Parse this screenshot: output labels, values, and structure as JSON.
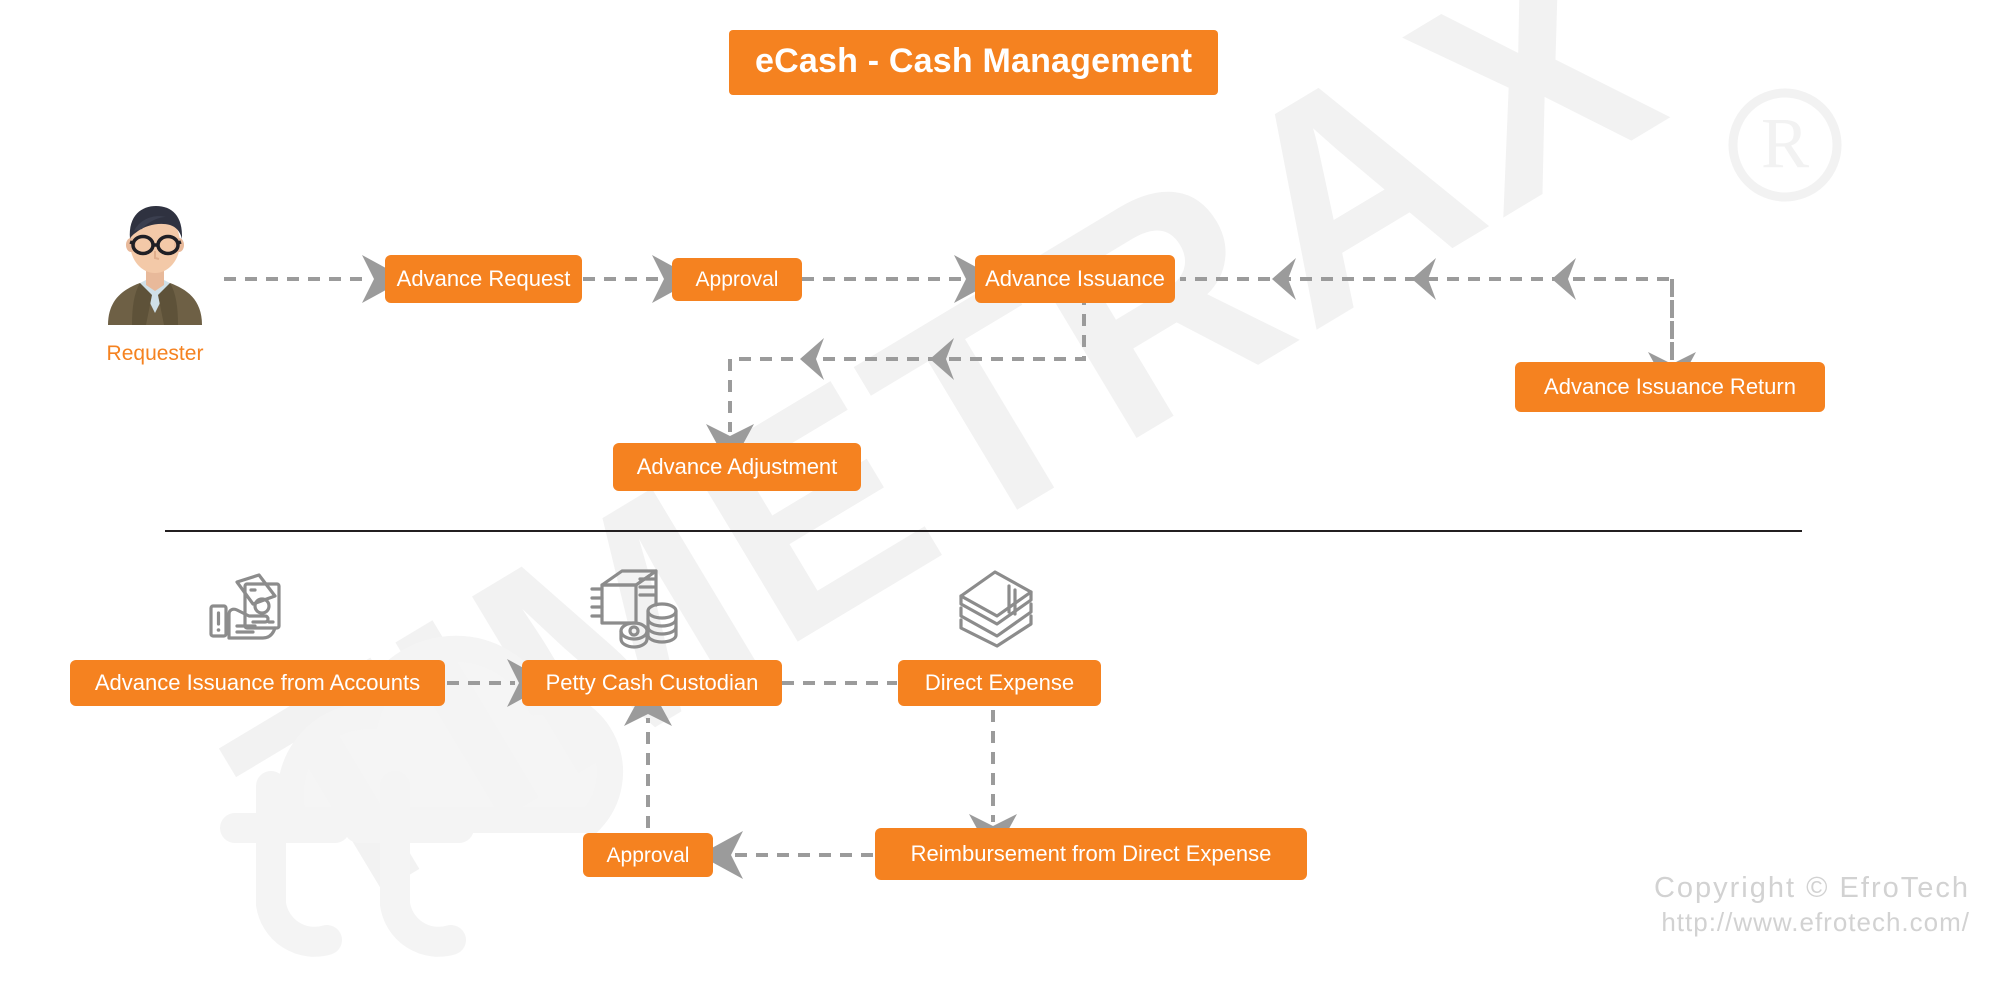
{
  "page": {
    "title": "eCash - Cash Management",
    "background_color": "#ffffff",
    "accent_color": "#F58220",
    "connector_color": "#9b9b9b",
    "divider_color": "#231f20",
    "watermark_text": "TIMETRAX",
    "watermark_registered_mark": "®"
  },
  "actor": {
    "label": "Requester",
    "icon": "person-avatar-icon"
  },
  "top_flow": {
    "nodes": [
      {
        "id": "advance-request",
        "label": "Advance Request"
      },
      {
        "id": "approval-top",
        "label": "Approval"
      },
      {
        "id": "advance-issuance",
        "label": "Advance Issuance"
      },
      {
        "id": "advance-issuance-return",
        "label": "Advance Issuance Return"
      },
      {
        "id": "advance-adjustment",
        "label": "Advance Adjustment"
      }
    ]
  },
  "bottom_flow": {
    "nodes": [
      {
        "id": "advance-issuance-from-accounts",
        "label": "Advance Issuance from Accounts",
        "icon": "hand-holding-cash-icon"
      },
      {
        "id": "petty-cash-custodian",
        "label": "Petty Cash Custodian",
        "icon": "cash-and-coins-icon"
      },
      {
        "id": "direct-expense",
        "label": "Direct Expense",
        "icon": "banknote-stack-icon"
      },
      {
        "id": "approval-bottom",
        "label": "Approval",
        "icon": ""
      },
      {
        "id": "reimbursement-from-direct-expense",
        "label": "Reimbursement from Direct Expense",
        "icon": ""
      }
    ]
  },
  "footer": {
    "copyright": "Copyright © EfroTech",
    "url": "http://www.efrotech.com/"
  }
}
